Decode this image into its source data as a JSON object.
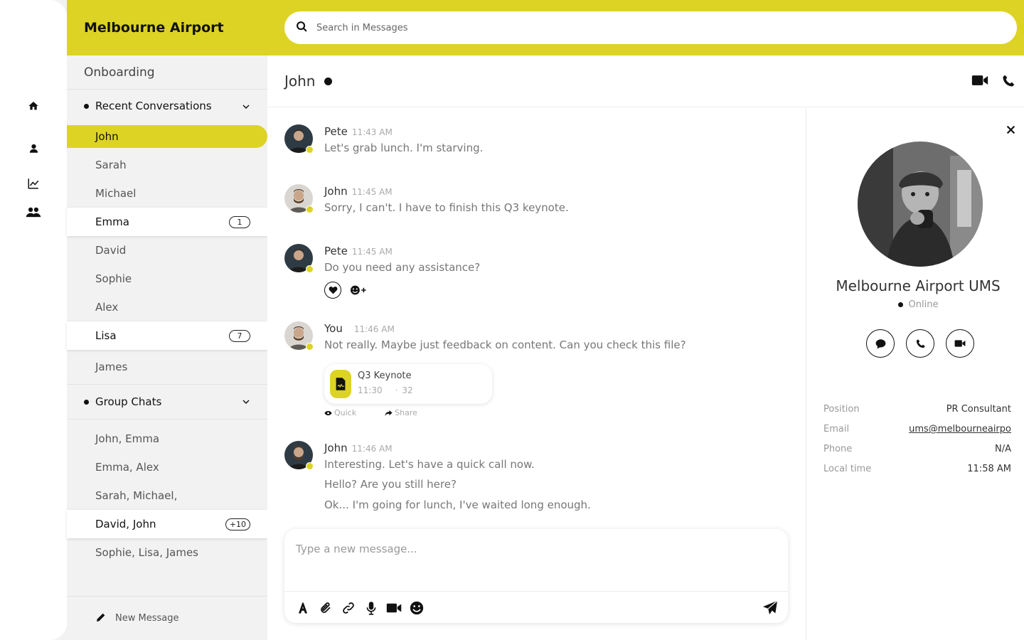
{
  "app": {
    "brand": "Melbourne Airport"
  },
  "search": {
    "placeholder": "Search in Messages"
  },
  "rail": {
    "icons": [
      "home-icon",
      "user-icon",
      "chart-icon",
      "group-icon"
    ]
  },
  "sidebar": {
    "workspace": "Onboarding",
    "recent": {
      "title": "Recent Conversations",
      "items": [
        {
          "label": "John",
          "state": "selected"
        },
        {
          "label": "Sarah"
        },
        {
          "label": "Michael"
        },
        {
          "label": "Emma",
          "badge": "1"
        },
        {
          "label": "David"
        },
        {
          "label": "Sophie"
        },
        {
          "label": "Alex"
        },
        {
          "label": "Lisa",
          "badge": "7"
        },
        {
          "label": "James"
        }
      ]
    },
    "groups": {
      "title": "Group Chats",
      "items": [
        {
          "label": "John, Emma"
        },
        {
          "label": "Emma, Alex"
        },
        {
          "label": "Sarah, Michael,"
        },
        {
          "label": "David, John",
          "badge": "+10"
        },
        {
          "label": "Sophie, Lisa, James"
        }
      ]
    },
    "new_message": "New Message"
  },
  "chat": {
    "title": "John",
    "messages": [
      {
        "sender": "Pete",
        "time": "11:43 AM",
        "lines": [
          "Let's grab lunch. I'm starving."
        ]
      },
      {
        "sender": "John",
        "time": "11:45 AM",
        "lines": [
          "Sorry, I can't. I have to finish this Q3 keynote."
        ]
      },
      {
        "sender": "Pete",
        "time": "11:45 AM",
        "lines": [
          "Do you need any assistance?"
        ]
      },
      {
        "sender": "You",
        "time": "11:46 AM",
        "lines": [
          "Not really. Maybe just feedback on content. Can you check this file?"
        ]
      },
      {
        "sender": "John",
        "time": "11:46 AM",
        "lines": [
          "Interesting. Let's have a quick call now.",
          "Hello? Are you still here?",
          "Ok... I'm going for lunch, I've waited long enough."
        ]
      }
    ],
    "attachment": {
      "name": "Q3 Keynote",
      "time": "11:30",
      "size": "32",
      "quick": "Quick",
      "share": "Share"
    },
    "composer": {
      "placeholder": "Type a new message..."
    }
  },
  "profile": {
    "name": "Melbourne Airport UMS",
    "status": "Online",
    "details": [
      {
        "key": "Position",
        "value": "PR Consultant"
      },
      {
        "key": "Email",
        "value": "ums@melbourneairpo"
      },
      {
        "key": "Phone",
        "value": "N/A"
      },
      {
        "key": "Local time",
        "value": "11:58 AM"
      }
    ]
  },
  "colors": {
    "accent": "#ddd324",
    "sidebar_bg": "#f2f2f2",
    "text": "#222222"
  }
}
